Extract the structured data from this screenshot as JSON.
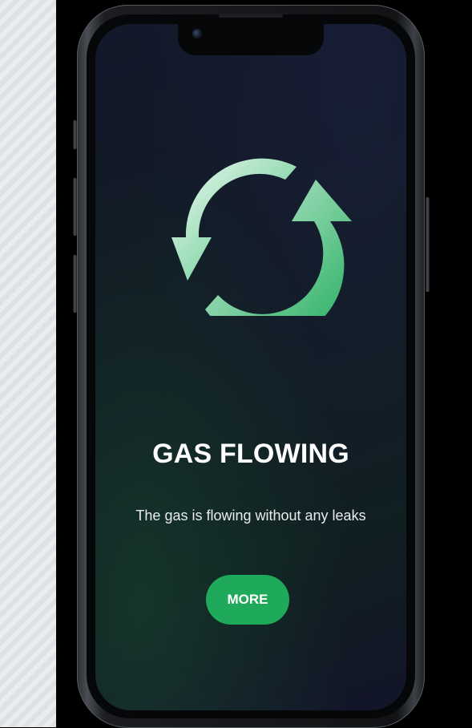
{
  "screen": {
    "status_icon": "refresh-arrows-icon",
    "title": "GAS FLOWING",
    "subtitle": "The gas is flowing without any leaks",
    "button_label": "MORE"
  },
  "colors": {
    "accent": "#1FA95A",
    "icon_gradient_start": "#E8F6EE",
    "icon_gradient_end": "#2DB865",
    "background": "#111A24"
  }
}
